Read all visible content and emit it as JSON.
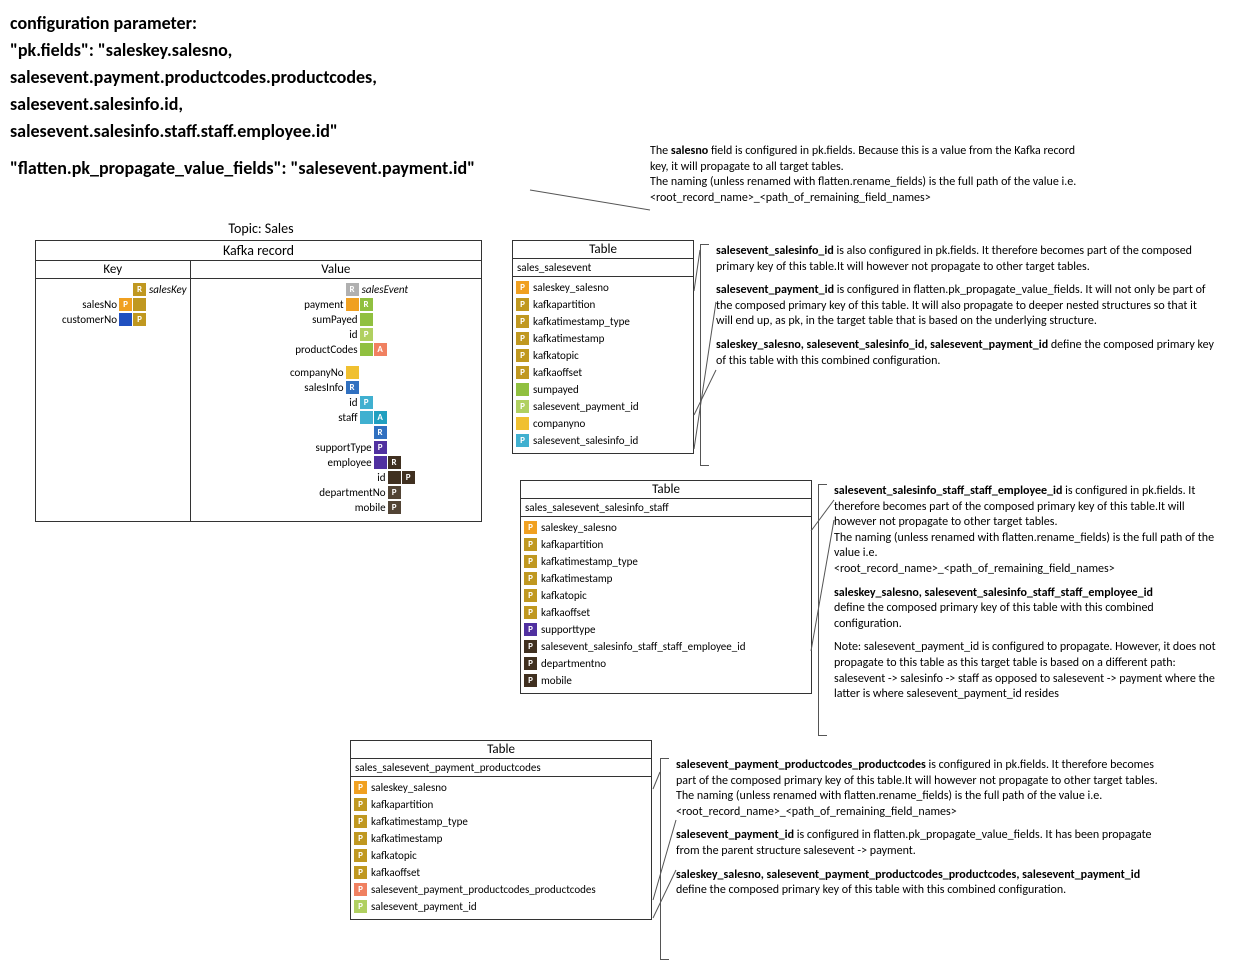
{
  "header": {
    "line1": "configuration parameter:",
    "line2": "\"pk.fields\": \"saleskey.salesno,",
    "line3": "salesevent.payment.productcodes.productcodes,",
    "line4": "salesevent.salesinfo.id,",
    "line5": "salesevent.salesinfo.staff.staff.employee.id\"",
    "line6": "\"flatten.pk_propagate_value_fields\": \"salesevent.payment.id\""
  },
  "topic_label": "Topic: Sales",
  "kafka_record": {
    "title": "Kafka record",
    "key_title": "Key",
    "value_title": "Value",
    "key_root": "salesKey",
    "key_fields": [
      "salesNo",
      "customerNo"
    ],
    "value_root": "salesEvent",
    "v_payment": "payment",
    "v_sumPayed": "sumPayed",
    "v_id": "id",
    "v_productCodes": "productCodes",
    "v_companyNo": "companyNo",
    "v_salesInfo": "salesInfo",
    "v_id2": "id",
    "v_staff": "staff",
    "v_supportType": "supportType",
    "v_employee": "employee",
    "v_id3": "id",
    "v_departmentNo": "departmentNo",
    "v_mobile": "mobile"
  },
  "table1": {
    "title": "Table",
    "name": "sales_salesevent",
    "rows": [
      "saleskey_salesno",
      "kafkapartition",
      "kafkatimestamp_type",
      "kafkatimestamp",
      "kafkatopic",
      "kafkaoffset",
      "sumpayed",
      "salesevent_payment_id",
      "companyno",
      "salesevent_salesinfo_id"
    ]
  },
  "table2": {
    "title": "Table",
    "name": "sales_salesevent_salesinfo_staff",
    "rows": [
      "saleskey_salesno",
      "kafkapartition",
      "kafkatimestamp_type",
      "kafkatimestamp",
      "kafkatopic",
      "kafkaoffset",
      "supporttype",
      "salesevent_salesinfo_staff_staff_employee_id",
      "departmentno",
      "mobile"
    ]
  },
  "table3": {
    "title": "Table",
    "name": "sales_salesevent_payment_productcodes",
    "rows": [
      "saleskey_salesno",
      "kafkapartition",
      "kafkatimestamp_type",
      "kafkatimestamp",
      "kafkatopic",
      "kafkaoffset",
      "salesevent_payment_productcodes_productcodes",
      "salesevent_payment_id"
    ]
  },
  "note0": {
    "t1a": "The ",
    "t1b": "salesno",
    "t1c": " field is configured in pk.fields. Because this is a value from the Kafka record key, it will propagate to all target tables.",
    "t2": "The naming (unless renamed with flatten.rename_fields) is the full path of the value i.e.",
    "t3": "<root_record_name>_<path_of_remaining_field_names>"
  },
  "note1": {
    "p1b": "salesevent_salesinfo_id",
    "p1t": " is also configured in pk.fields. It therefore becomes part of the composed primary key of this table.It will however not propagate to other target tables.",
    "p2b": "salesevent_payment_id",
    "p2t": " is configured in flatten.pk_propagate_value_fields. It will not only be part of the composed primary key of this table. It will also propagate to deeper nested structures so that it will end up, as pk, in the target table that is based on the underlying structure.",
    "p3b": "saleskey_salesno, salesevent_salesinfo_id, salesevent_payment_id",
    "p3t": " define the composed primary key of this table with this combined configuration."
  },
  "note2": {
    "p1b": "salesevent_salesinfo_staff_staff_employee_id",
    "p1t": " is configured in pk.fields. It therefore becomes part of the composed primary key of this table.It will however not propagate to other target tables.",
    "p2": "The naming (unless renamed with flatten.rename_fields) is the full path of the value i.e.",
    "p3": "<root_record_name>_<path_of_remaining_field_names>",
    "p4b": "saleskey_salesno, salesevent_salesinfo_staff_staff_employee_id",
    "p4t": " define the composed primary key of this table with this combined configuration.",
    "p5": "Note: salesevent_payment_id is configured to propagate. However, it does not propagate to this table as this target table is based on a different path: salesevent -> salesinfo -> staff as opposed to salesevent -> payment where the latter is where salesevent_payment_id resides"
  },
  "note3": {
    "p1b": "salesevent_payment_productcodes_productcodes",
    "p1t": " is configured in pk.fields. It therefore becomes part of the composed primary key of this table.It will however not propagate to other target tables.",
    "p2": "The naming (unless renamed with flatten.rename_fields) is the full path of the value i.e.",
    "p3": "<root_record_name>_<path_of_remaining_field_names>",
    "p4b": "salesevent_payment_id",
    "p4t": " is configured in flatten.pk_propagate_value_fields. It has been propagate from the parent structure salesevent -> payment.",
    "p5b": "saleskey_salesno, salesevent_payment_productcodes_productcodes, salesevent_payment_id",
    "p5t": " define the composed primary key of this table with this combined configuration."
  }
}
